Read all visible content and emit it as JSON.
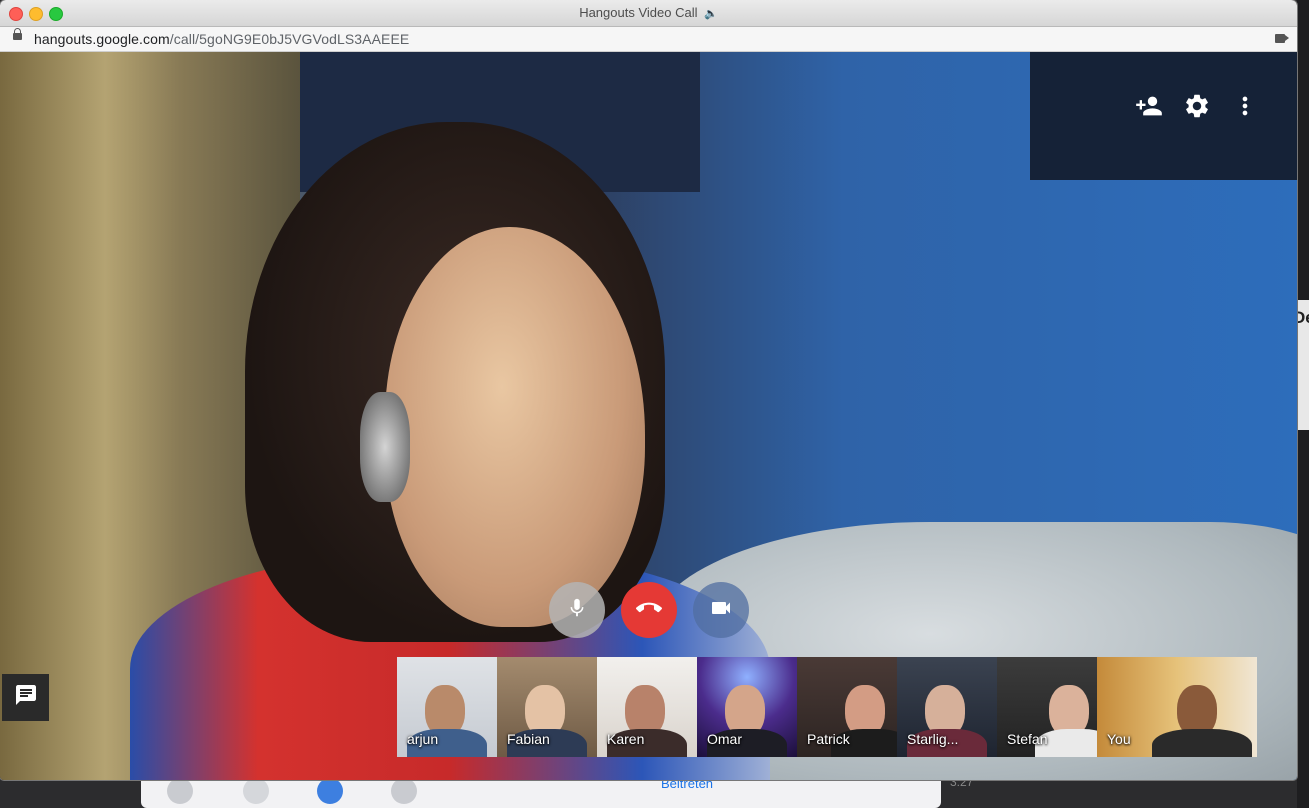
{
  "window": {
    "title": "Hangouts Video Call",
    "title_icon": "speaker-icon",
    "url_host": "hangouts.google.com",
    "url_path": "/call/5goNG9E0bJ5VGVodLS3AAEEE"
  },
  "top_controls": [
    "add-person-icon",
    "gear-icon",
    "more-vert-icon"
  ],
  "call_controls": {
    "mic": "mic-icon",
    "hangup": "call-end-icon",
    "camera": "videocam-icon",
    "colors": {
      "hangup": "#e53935",
      "mic": "#b4b4b4",
      "camera": "#506ea0"
    }
  },
  "chat_button_icon": "chat-icon",
  "participants": [
    {
      "name": "arjun"
    },
    {
      "name": "Fabian"
    },
    {
      "name": "Karen"
    },
    {
      "name": "Omar"
    },
    {
      "name": "Patrick"
    },
    {
      "name": "Starlig..."
    },
    {
      "name": "Stefan"
    },
    {
      "name": "You"
    }
  ],
  "background": {
    "join_label": "Beitreten",
    "side_text": "De",
    "time_text": "3:27"
  }
}
